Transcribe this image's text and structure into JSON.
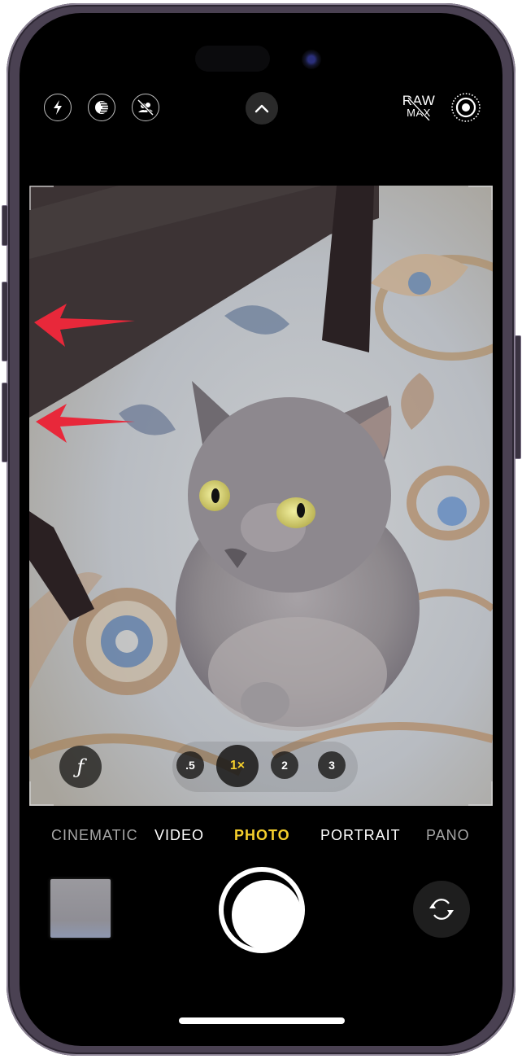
{
  "app": "Camera",
  "top_controls": {
    "flash": {
      "icon": "flash-icon",
      "state": "auto"
    },
    "night_mode": {
      "icon": "night-mode-icon"
    },
    "live_photo_off": {
      "icon": "live-portrait-off-icon"
    },
    "expand": {
      "icon": "chevron-up-icon"
    },
    "raw": {
      "line1": "RAW",
      "line2": "MAX",
      "state": "off"
    },
    "live_photos": {
      "icon": "live-photo-icon"
    }
  },
  "viewfinder": {
    "subject": "grey long-haired cat on patterned rug",
    "annotations": [
      {
        "type": "arrow",
        "direction": "left",
        "color": "#e8283a"
      },
      {
        "type": "arrow",
        "direction": "left",
        "color": "#e8283a"
      }
    ]
  },
  "aperture_button": {
    "label": "ƒ"
  },
  "zoom_levels": [
    {
      "label": ".5",
      "active": false
    },
    {
      "label": "1×",
      "active": true
    },
    {
      "label": "2",
      "active": false
    },
    {
      "label": "3",
      "active": false
    }
  ],
  "modes": [
    {
      "label": "CINEMATIC",
      "active": false
    },
    {
      "label": "VIDEO",
      "active": false
    },
    {
      "label": "PHOTO",
      "active": true
    },
    {
      "label": "PORTRAIT",
      "active": false
    },
    {
      "label": "PANO",
      "active": false
    }
  ],
  "bottom_controls": {
    "thumbnail": {
      "icon": "last-photo-thumbnail"
    },
    "shutter": {
      "icon": "shutter-button"
    },
    "flip": {
      "icon": "camera-flip-icon"
    }
  },
  "colors": {
    "accent_yellow": "#f5cf2c",
    "arrow_red": "#e8283a",
    "frame": "#4a4152"
  }
}
